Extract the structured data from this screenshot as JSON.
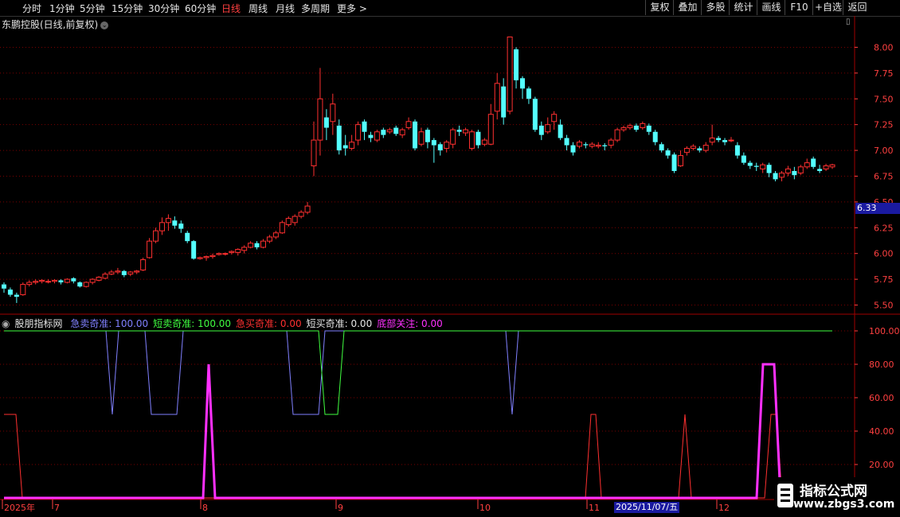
{
  "toolbar": {
    "periods": [
      "分时",
      "1分钟",
      "5分钟",
      "15分钟",
      "30分钟",
      "60分钟",
      "日线",
      "周线",
      "月线",
      "多周期",
      "更多 >"
    ],
    "active_period": "日线",
    "right_buttons": [
      "复权",
      "叠加",
      "多股",
      "统计",
      "画线",
      "F10",
      "+自选",
      "返回"
    ]
  },
  "stock": {
    "title": "东鹏控股(日线,前复权)",
    "current_price": "6.33"
  },
  "indicator": {
    "name": "股朋指标网",
    "fields": [
      {
        "label": "急卖奇准: 100.00",
        "color": "#8080ff"
      },
      {
        "label": "短卖奇准: 100.00",
        "color": "#40ff40"
      },
      {
        "label": "急买奇准: 0.00",
        "color": "#ff3030"
      },
      {
        "label": "短买奇准: 0.00",
        "color": "#e6e6e6"
      },
      {
        "label": "底部关注: 0.00",
        "color": "#ff30ff"
      }
    ]
  },
  "axes": {
    "price_ticks": [
      "8.00",
      "7.75",
      "7.50",
      "7.25",
      "7.00",
      "6.75",
      "6.50",
      "6.25",
      "6.00",
      "5.75",
      "5.50"
    ],
    "indicator_ticks": [
      "100.00",
      "80.00",
      "60.00",
      "40.00",
      "20.00"
    ],
    "dates": [
      "2025年",
      "7",
      "8",
      "9",
      "10",
      "11",
      "12"
    ],
    "cursor_date": "2025/11/07/五"
  },
  "watermark": {
    "line1": "指标公式网",
    "line2": "www.zbgs3.com"
  },
  "colors": {
    "up": "#ff3030",
    "down": "#54ffff",
    "grid": "#7a0000"
  },
  "chart_data": {
    "type": "candlestick",
    "candles": [
      [
        5.7,
        5.66,
        5.72,
        5.62
      ],
      [
        5.65,
        5.6,
        5.67,
        5.58
      ],
      [
        5.6,
        5.58,
        5.62,
        5.52
      ],
      [
        5.6,
        5.7,
        5.72,
        5.59
      ],
      [
        5.7,
        5.72,
        5.74,
        5.68
      ],
      [
        5.72,
        5.73,
        5.75,
        5.7
      ],
      [
        5.73,
        5.74,
        5.75,
        5.71
      ],
      [
        5.73,
        5.73,
        5.75,
        5.71
      ],
      [
        5.73,
        5.74,
        5.75,
        5.71
      ],
      [
        5.74,
        5.72,
        5.75,
        5.7
      ],
      [
        5.72,
        5.75,
        5.76,
        5.71
      ],
      [
        5.76,
        5.73,
        5.77,
        5.71
      ],
      [
        5.72,
        5.68,
        5.73,
        5.67
      ],
      [
        5.68,
        5.72,
        5.73,
        5.67
      ],
      [
        5.72,
        5.75,
        5.76,
        5.7
      ],
      [
        5.74,
        5.77,
        5.78,
        5.73
      ],
      [
        5.76,
        5.8,
        5.82,
        5.75
      ],
      [
        5.8,
        5.82,
        5.84,
        5.79
      ],
      [
        5.82,
        5.83,
        5.86,
        5.8
      ],
      [
        5.83,
        5.79,
        5.84,
        5.77
      ],
      [
        5.8,
        5.82,
        5.83,
        5.78
      ],
      [
        5.82,
        5.83,
        5.84,
        5.8
      ],
      [
        5.84,
        5.94,
        5.96,
        5.83
      ],
      [
        5.96,
        6.12,
        6.15,
        5.95
      ],
      [
        6.12,
        6.22,
        6.25,
        6.1
      ],
      [
        6.22,
        6.3,
        6.35,
        6.18
      ],
      [
        6.3,
        6.34,
        6.38,
        6.22
      ],
      [
        6.32,
        6.27,
        6.36,
        6.24
      ],
      [
        6.29,
        6.24,
        6.32,
        6.2
      ],
      [
        6.2,
        6.12,
        6.22,
        6.1
      ],
      [
        6.12,
        5.95,
        6.13,
        5.94
      ],
      [
        5.95,
        5.96,
        5.97,
        5.94
      ],
      [
        5.96,
        5.97,
        5.98,
        5.93
      ],
      [
        5.97,
        5.98,
        6.0,
        5.95
      ],
      [
        5.99,
        6.0,
        6.01,
        5.98
      ],
      [
        6.0,
        6.0,
        6.01,
        5.98
      ],
      [
        6.01,
        6.02,
        6.03,
        5.99
      ],
      [
        6.01,
        6.04,
        6.05,
        5.98
      ],
      [
        6.03,
        6.06,
        6.08,
        6.0
      ],
      [
        6.06,
        6.1,
        6.12,
        6.05
      ],
      [
        6.1,
        6.06,
        6.12,
        6.04
      ],
      [
        6.06,
        6.12,
        6.14,
        6.05
      ],
      [
        6.12,
        6.16,
        6.18,
        6.1
      ],
      [
        6.16,
        6.2,
        6.22,
        6.14
      ],
      [
        6.2,
        6.3,
        6.32,
        6.19
      ],
      [
        6.28,
        6.34,
        6.36,
        6.26
      ],
      [
        6.3,
        6.36,
        6.38,
        6.27
      ],
      [
        6.36,
        6.4,
        6.42,
        6.34
      ],
      [
        6.4,
        6.46,
        6.5,
        6.38
      ],
      [
        6.85,
        7.1,
        7.28,
        6.75
      ],
      [
        7.1,
        7.5,
        7.8,
        6.95
      ],
      [
        7.32,
        7.22,
        7.4,
        7.1
      ],
      [
        7.28,
        7.45,
        7.55,
        7.15
      ],
      [
        7.24,
        7.0,
        7.3,
        6.96
      ],
      [
        7.05,
        7.02,
        7.15,
        6.95
      ],
      [
        7.02,
        7.08,
        7.15,
        7.0
      ],
      [
        7.1,
        7.25,
        7.28,
        7.05
      ],
      [
        7.28,
        7.18,
        7.3,
        7.1
      ],
      [
        7.15,
        7.12,
        7.18,
        7.08
      ],
      [
        7.1,
        7.18,
        7.2,
        7.08
      ],
      [
        7.2,
        7.15,
        7.22,
        7.12
      ],
      [
        7.18,
        7.2,
        7.22,
        7.16
      ],
      [
        7.22,
        7.16,
        7.24,
        7.14
      ],
      [
        7.15,
        7.2,
        7.22,
        7.12
      ],
      [
        7.22,
        7.28,
        7.32,
        7.2
      ],
      [
        7.28,
        7.02,
        7.3,
        7.0
      ],
      [
        7.06,
        7.18,
        7.22,
        7.04
      ],
      [
        7.2,
        7.08,
        7.22,
        7.02
      ],
      [
        7.1,
        7.05,
        7.12,
        6.88
      ],
      [
        7.06,
        7.0,
        7.08,
        6.95
      ],
      [
        7.02,
        7.08,
        7.1,
        6.98
      ],
      [
        7.06,
        7.2,
        7.22,
        7.02
      ],
      [
        7.2,
        7.18,
        7.24,
        7.14
      ],
      [
        7.17,
        7.2,
        7.22,
        7.14
      ],
      [
        7.02,
        7.18,
        7.2,
        7.0
      ],
      [
        7.18,
        7.05,
        7.2,
        7.02
      ],
      [
        7.06,
        7.1,
        7.12,
        7.04
      ],
      [
        7.06,
        7.35,
        7.45,
        7.05
      ],
      [
        7.38,
        7.65,
        7.75,
        7.3
      ],
      [
        7.62,
        7.32,
        7.7,
        7.25
      ],
      [
        7.38,
        8.1,
        8.1,
        7.35
      ],
      [
        7.98,
        7.68,
        8.0,
        7.6
      ],
      [
        7.7,
        7.6,
        7.72,
        7.5
      ],
      [
        7.6,
        7.5,
        7.62,
        7.45
      ],
      [
        7.5,
        7.2,
        7.52,
        7.18
      ],
      [
        7.24,
        7.15,
        7.28,
        7.1
      ],
      [
        7.18,
        7.25,
        7.32,
        7.16
      ],
      [
        7.28,
        7.35,
        7.38,
        7.2
      ],
      [
        7.25,
        7.12,
        7.3,
        7.1
      ],
      [
        7.12,
        7.05,
        7.15,
        7.0
      ],
      [
        7.05,
        6.98,
        7.08,
        6.95
      ],
      [
        7.04,
        7.08,
        7.1,
        7.02
      ],
      [
        7.06,
        7.05,
        7.08,
        7.02
      ],
      [
        7.04,
        7.06,
        7.08,
        7.02
      ],
      [
        7.04,
        7.05,
        7.08,
        7.02
      ],
      [
        7.05,
        7.04,
        7.07,
        7.0
      ],
      [
        7.05,
        7.1,
        7.12,
        7.02
      ],
      [
        7.1,
        7.2,
        7.22,
        7.08
      ],
      [
        7.2,
        7.22,
        7.24,
        7.18
      ],
      [
        7.22,
        7.24,
        7.26,
        7.2
      ],
      [
        7.24,
        7.2,
        7.26,
        7.18
      ],
      [
        7.22,
        7.26,
        7.28,
        7.2
      ],
      [
        7.24,
        7.18,
        7.26,
        7.15
      ],
      [
        7.18,
        7.08,
        7.2,
        7.05
      ],
      [
        7.06,
        7.0,
        7.08,
        6.98
      ],
      [
        7.0,
        6.95,
        7.02,
        6.92
      ],
      [
        6.96,
        6.8,
        6.98,
        6.78
      ],
      [
        6.85,
        6.95,
        7.0,
        6.84
      ],
      [
        6.98,
        7.02,
        7.04,
        6.95
      ],
      [
        7.02,
        7.04,
        7.06,
        7.0
      ],
      [
        7.02,
        7.0,
        7.04,
        6.98
      ],
      [
        7.0,
        7.05,
        7.08,
        6.98
      ],
      [
        7.08,
        7.12,
        7.25,
        7.05
      ],
      [
        7.12,
        7.1,
        7.14,
        7.08
      ],
      [
        7.1,
        7.08,
        7.12,
        7.05
      ],
      [
        7.1,
        7.1,
        7.13,
        7.08
      ],
      [
        7.05,
        6.95,
        7.08,
        6.92
      ],
      [
        6.95,
        6.88,
        6.98,
        6.86
      ],
      [
        6.88,
        6.85,
        6.9,
        6.82
      ],
      [
        6.85,
        6.84,
        6.88,
        6.8
      ],
      [
        6.82,
        6.86,
        6.88,
        6.78
      ],
      [
        6.86,
        6.78,
        6.88,
        6.74
      ],
      [
        6.78,
        6.72,
        6.8,
        6.7
      ],
      [
        6.74,
        6.78,
        6.8,
        6.7
      ],
      [
        6.78,
        6.82,
        6.85,
        6.75
      ],
      [
        6.8,
        6.76,
        6.84,
        6.72
      ],
      [
        6.78,
        6.84,
        6.86,
        6.76
      ],
      [
        6.84,
        6.88,
        6.92,
        6.82
      ],
      [
        6.92,
        6.84,
        6.94,
        6.82
      ],
      [
        6.82,
        6.8,
        6.86,
        6.78
      ],
      [
        6.82,
        6.85,
        6.87,
        6.8
      ],
      [
        6.84,
        6.86,
        6.87,
        6.82
      ]
    ],
    "ylim": [
      5.45,
      8.15
    ],
    "indicator_series": [
      {
        "name": "急卖奇准",
        "color": "#8080ff"
      },
      {
        "name": "短卖奇准",
        "color": "#40ff40"
      },
      {
        "name": "急买奇准",
        "color": "#ff3030"
      },
      {
        "name": "底部关注",
        "color": "#ff30ff"
      }
    ],
    "indicator_ylim": [
      0,
      100
    ]
  }
}
